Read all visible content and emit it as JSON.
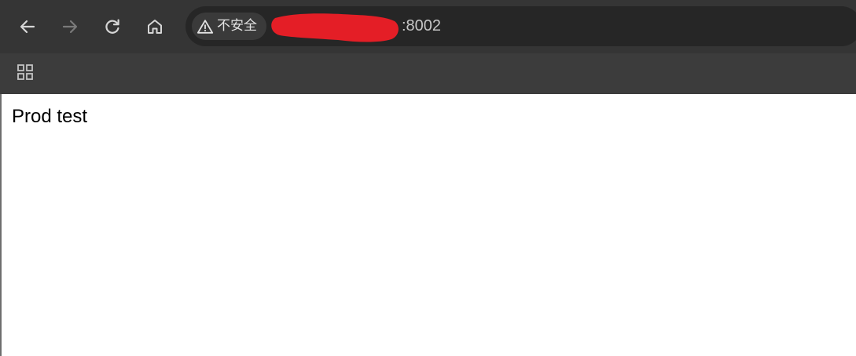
{
  "toolbar": {
    "back_tooltip": "Back",
    "forward_tooltip": "Forward",
    "reload_tooltip": "Reload",
    "home_tooltip": "Home",
    "back_icon": "arrow-left-icon",
    "forward_icon": "arrow-right-icon",
    "reload_icon": "reload-icon",
    "home_icon": "home-icon",
    "forward_enabled": false
  },
  "omnibox": {
    "security_label": "不安全",
    "security_icon": "warning-triangle-icon",
    "url_visible": ":8002",
    "url_redacted": true
  },
  "bookmarks": {
    "apps_tooltip": "Apps",
    "apps_icon": "apps-grid-icon"
  },
  "page": {
    "text": "Prod test"
  },
  "colors": {
    "toolbar_bg": "#353535",
    "bookmarks_bg": "#3c3c3c",
    "omnibox_bg": "#262626",
    "redaction": "#e41e26",
    "page_bg": "#ffffff"
  }
}
